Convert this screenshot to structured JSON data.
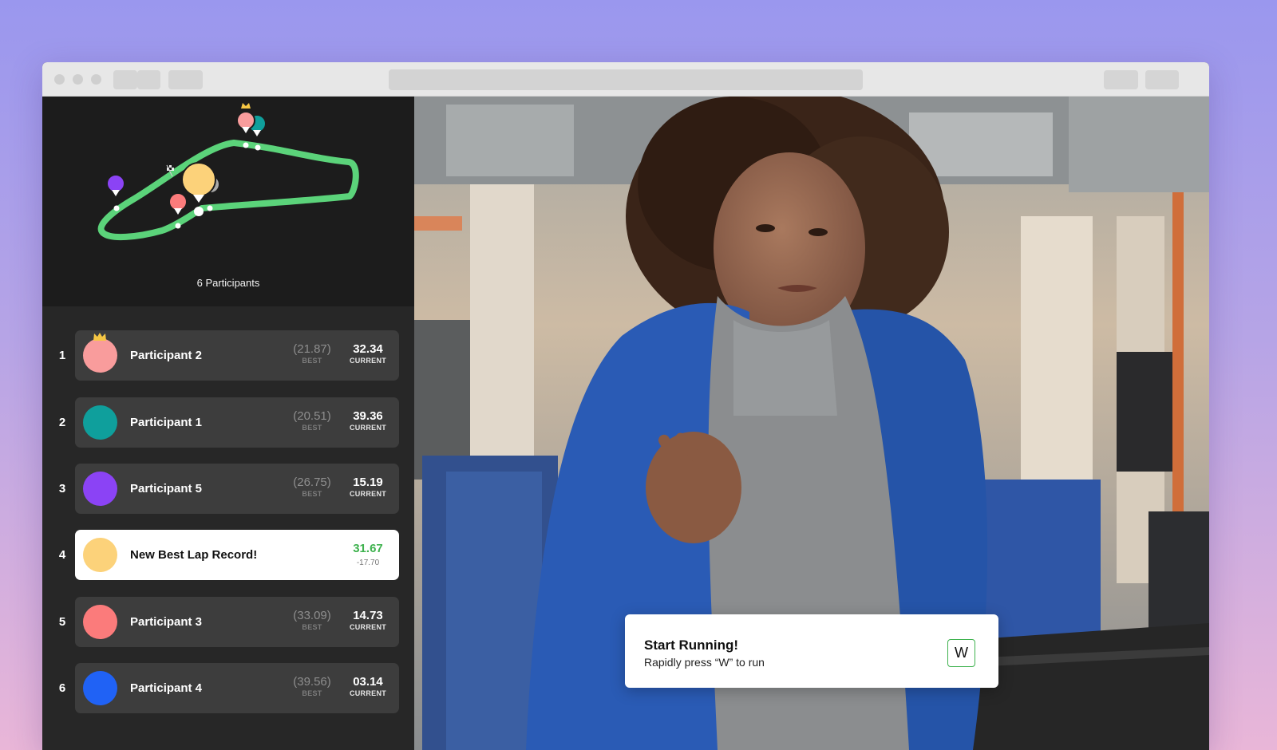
{
  "map": {
    "participants_label": "6 Participants"
  },
  "leaderboard": [
    {
      "rank": "1",
      "name": "Participant 2",
      "best": "(21.87)",
      "best_label": "BEST",
      "current": "32.34",
      "current_label": "CURRENT",
      "color": "#f99c9c",
      "crown": true
    },
    {
      "rank": "2",
      "name": "Participant 1",
      "best": "(20.51)",
      "best_label": "BEST",
      "current": "39.36",
      "current_label": "CURRENT",
      "color": "#0f9f9c"
    },
    {
      "rank": "3",
      "name": "Participant 5",
      "best": "(26.75)",
      "best_label": "BEST",
      "current": "15.19",
      "current_label": "CURRENT",
      "color": "#8b43f5"
    },
    {
      "rank": "4",
      "name": "New Best Lap Record!",
      "record_time": "31.67",
      "record_delta": "-17.70",
      "color": "#fcd27a",
      "highlight": true
    },
    {
      "rank": "5",
      "name": "Participant 3",
      "best": "(33.09)",
      "best_label": "BEST",
      "current": "14.73",
      "current_label": "CURRENT",
      "color": "#fb7b7b"
    },
    {
      "rank": "6",
      "name": "Participant 4",
      "best": "(39.56)",
      "best_label": "BEST",
      "current": "03.14",
      "current_label": "CURRENT",
      "color": "#2062f5"
    }
  ],
  "toast": {
    "title": "Start Running!",
    "subtitle": "Rapidly press “W” to run",
    "key": "W"
  }
}
